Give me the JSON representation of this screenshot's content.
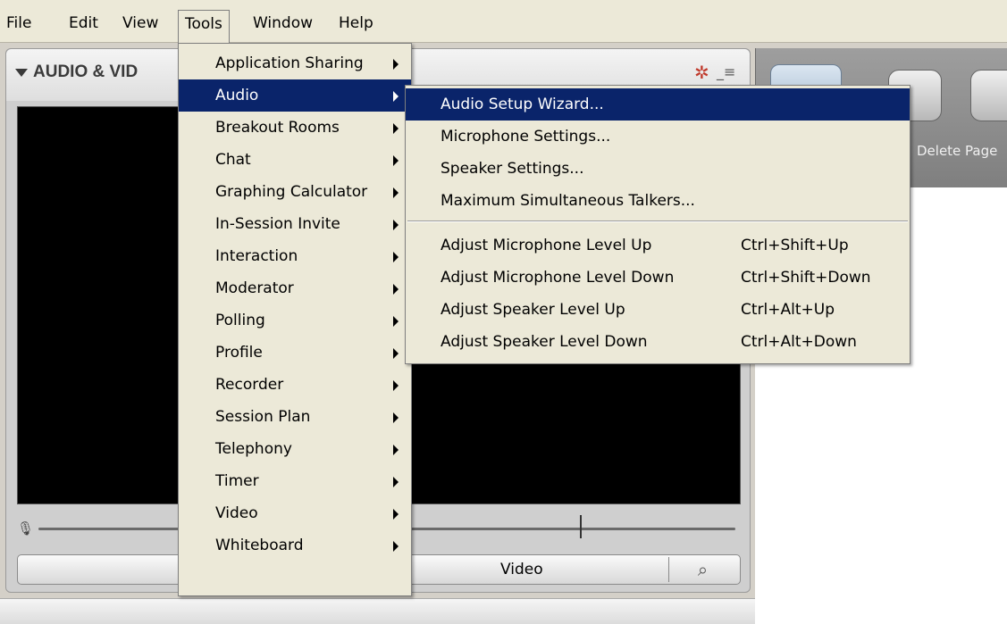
{
  "menubar": {
    "items": [
      "File",
      "Edit",
      "View",
      "Tools",
      "Window",
      "Help"
    ],
    "active": "Tools"
  },
  "panel": {
    "title": "AUDIO & VID",
    "video_button_label": "Video"
  },
  "toolbar": {
    "delete_page_label": "Delete Page"
  },
  "tools_menu": {
    "items": [
      "Application Sharing",
      "Audio",
      "Breakout Rooms",
      "Chat",
      "Graphing Calculator",
      "In-Session Invite",
      "Interaction",
      "Moderator",
      "Polling",
      "Profile",
      "Recorder",
      "Session Plan",
      "Telephony",
      "Timer",
      "Video",
      "Whiteboard"
    ],
    "highlighted": "Audio"
  },
  "audio_menu": {
    "items": [
      {
        "label": "Audio Setup Wizard...",
        "shortcut": ""
      },
      {
        "label": "Microphone Settings...",
        "shortcut": ""
      },
      {
        "label": "Speaker Settings...",
        "shortcut": ""
      },
      {
        "label": "Maximum Simultaneous Talkers...",
        "shortcut": ""
      },
      {
        "label": "Adjust Microphone Level Up",
        "shortcut": "Ctrl+Shift+Up"
      },
      {
        "label": "Adjust Microphone Level Down",
        "shortcut": "Ctrl+Shift+Down"
      },
      {
        "label": "Adjust Speaker Level Up",
        "shortcut": "Ctrl+Alt+Up"
      },
      {
        "label": "Adjust Speaker Level Down",
        "shortcut": "Ctrl+Alt+Down"
      }
    ],
    "highlighted": "Audio Setup Wizard..."
  },
  "colors": {
    "menu_highlight": "#0a246a",
    "menu_bg": "#ece9d8"
  },
  "icons": [
    "caret-down-icon",
    "gear-icon",
    "menu-icon",
    "mic-icon",
    "zoom-icon",
    "submenu-arrow-icon"
  ]
}
